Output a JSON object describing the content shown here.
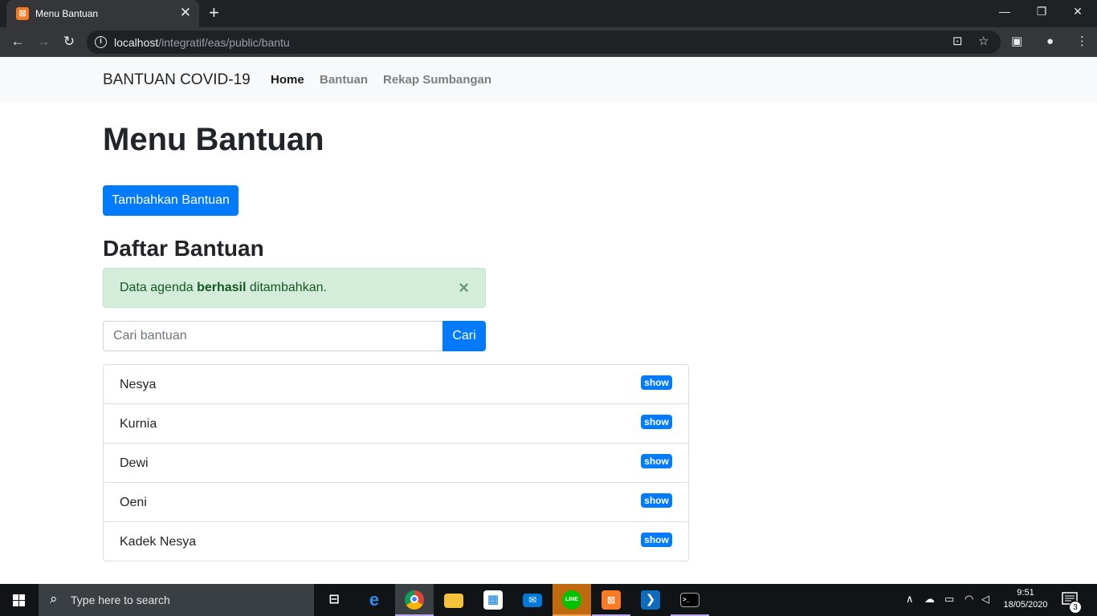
{
  "browser": {
    "tab_title": "Menu Bantuan",
    "tab_favicon": "xampp-icon",
    "url_host": "localhost",
    "url_path": "/integratif/eas/public/bantu"
  },
  "site": {
    "brand": "BANTUAN COVID-19",
    "nav": [
      {
        "label": "Home",
        "active": true
      },
      {
        "label": "Bantuan",
        "active": false
      },
      {
        "label": "Rekap Sumbangan",
        "active": false
      }
    ]
  },
  "main": {
    "title": "Menu Bantuan",
    "add_button": "Tambahkan Bantuan",
    "list_title": "Daftar Bantuan",
    "alert": {
      "prefix": "Data agenda ",
      "strong": "berhasil",
      "suffix": " ditambahkan.",
      "close": "×"
    },
    "search": {
      "placeholder": "Cari bantuan",
      "button": "Cari"
    },
    "items": [
      {
        "name": "Nesya",
        "action": "show"
      },
      {
        "name": "Kurnia",
        "action": "show"
      },
      {
        "name": "Dewi",
        "action": "show"
      },
      {
        "name": "Oeni",
        "action": "show"
      },
      {
        "name": "Kadek Nesya",
        "action": "show"
      }
    ]
  },
  "taskbar": {
    "search_placeholder": "Type here to search",
    "time": "9:51",
    "date": "18/05/2020",
    "notification_count": "3",
    "line_label": "LINE"
  },
  "colors": {
    "primary": "#007bff",
    "alert_bg": "#d4edda",
    "alert_text": "#155724",
    "navbar_bg": "#f8f9fa"
  }
}
